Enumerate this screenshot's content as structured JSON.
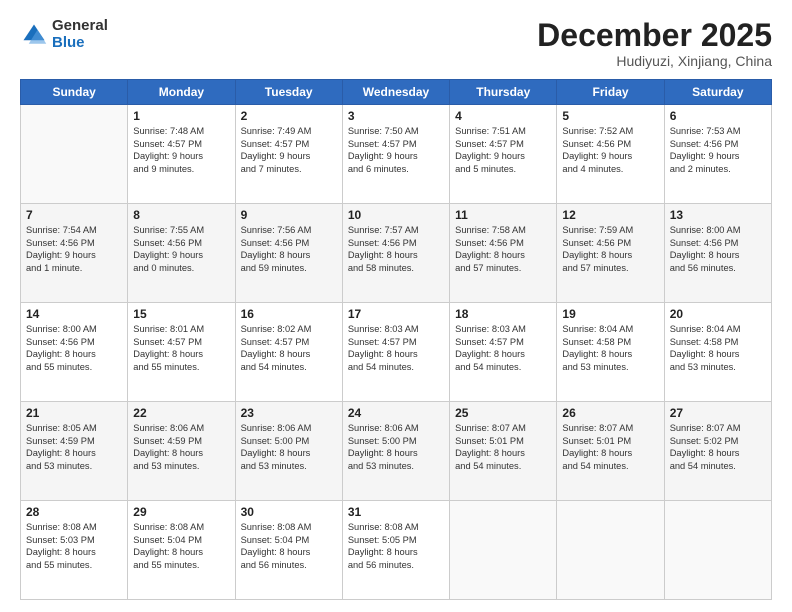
{
  "logo": {
    "general": "General",
    "blue": "Blue"
  },
  "header": {
    "title": "December 2025",
    "subtitle": "Hudiyuzi, Xinjiang, China"
  },
  "weekdays": [
    "Sunday",
    "Monday",
    "Tuesday",
    "Wednesday",
    "Thursday",
    "Friday",
    "Saturday"
  ],
  "weeks": [
    [
      {
        "day": "",
        "lines": []
      },
      {
        "day": "1",
        "lines": [
          "Sunrise: 7:48 AM",
          "Sunset: 4:57 PM",
          "Daylight: 9 hours",
          "and 9 minutes."
        ]
      },
      {
        "day": "2",
        "lines": [
          "Sunrise: 7:49 AM",
          "Sunset: 4:57 PM",
          "Daylight: 9 hours",
          "and 7 minutes."
        ]
      },
      {
        "day": "3",
        "lines": [
          "Sunrise: 7:50 AM",
          "Sunset: 4:57 PM",
          "Daylight: 9 hours",
          "and 6 minutes."
        ]
      },
      {
        "day": "4",
        "lines": [
          "Sunrise: 7:51 AM",
          "Sunset: 4:57 PM",
          "Daylight: 9 hours",
          "and 5 minutes."
        ]
      },
      {
        "day": "5",
        "lines": [
          "Sunrise: 7:52 AM",
          "Sunset: 4:56 PM",
          "Daylight: 9 hours",
          "and 4 minutes."
        ]
      },
      {
        "day": "6",
        "lines": [
          "Sunrise: 7:53 AM",
          "Sunset: 4:56 PM",
          "Daylight: 9 hours",
          "and 2 minutes."
        ]
      }
    ],
    [
      {
        "day": "7",
        "lines": [
          "Sunrise: 7:54 AM",
          "Sunset: 4:56 PM",
          "Daylight: 9 hours",
          "and 1 minute."
        ]
      },
      {
        "day": "8",
        "lines": [
          "Sunrise: 7:55 AM",
          "Sunset: 4:56 PM",
          "Daylight: 9 hours",
          "and 0 minutes."
        ]
      },
      {
        "day": "9",
        "lines": [
          "Sunrise: 7:56 AM",
          "Sunset: 4:56 PM",
          "Daylight: 8 hours",
          "and 59 minutes."
        ]
      },
      {
        "day": "10",
        "lines": [
          "Sunrise: 7:57 AM",
          "Sunset: 4:56 PM",
          "Daylight: 8 hours",
          "and 58 minutes."
        ]
      },
      {
        "day": "11",
        "lines": [
          "Sunrise: 7:58 AM",
          "Sunset: 4:56 PM",
          "Daylight: 8 hours",
          "and 57 minutes."
        ]
      },
      {
        "day": "12",
        "lines": [
          "Sunrise: 7:59 AM",
          "Sunset: 4:56 PM",
          "Daylight: 8 hours",
          "and 57 minutes."
        ]
      },
      {
        "day": "13",
        "lines": [
          "Sunrise: 8:00 AM",
          "Sunset: 4:56 PM",
          "Daylight: 8 hours",
          "and 56 minutes."
        ]
      }
    ],
    [
      {
        "day": "14",
        "lines": [
          "Sunrise: 8:00 AM",
          "Sunset: 4:56 PM",
          "Daylight: 8 hours",
          "and 55 minutes."
        ]
      },
      {
        "day": "15",
        "lines": [
          "Sunrise: 8:01 AM",
          "Sunset: 4:57 PM",
          "Daylight: 8 hours",
          "and 55 minutes."
        ]
      },
      {
        "day": "16",
        "lines": [
          "Sunrise: 8:02 AM",
          "Sunset: 4:57 PM",
          "Daylight: 8 hours",
          "and 54 minutes."
        ]
      },
      {
        "day": "17",
        "lines": [
          "Sunrise: 8:03 AM",
          "Sunset: 4:57 PM",
          "Daylight: 8 hours",
          "and 54 minutes."
        ]
      },
      {
        "day": "18",
        "lines": [
          "Sunrise: 8:03 AM",
          "Sunset: 4:57 PM",
          "Daylight: 8 hours",
          "and 54 minutes."
        ]
      },
      {
        "day": "19",
        "lines": [
          "Sunrise: 8:04 AM",
          "Sunset: 4:58 PM",
          "Daylight: 8 hours",
          "and 53 minutes."
        ]
      },
      {
        "day": "20",
        "lines": [
          "Sunrise: 8:04 AM",
          "Sunset: 4:58 PM",
          "Daylight: 8 hours",
          "and 53 minutes."
        ]
      }
    ],
    [
      {
        "day": "21",
        "lines": [
          "Sunrise: 8:05 AM",
          "Sunset: 4:59 PM",
          "Daylight: 8 hours",
          "and 53 minutes."
        ]
      },
      {
        "day": "22",
        "lines": [
          "Sunrise: 8:06 AM",
          "Sunset: 4:59 PM",
          "Daylight: 8 hours",
          "and 53 minutes."
        ]
      },
      {
        "day": "23",
        "lines": [
          "Sunrise: 8:06 AM",
          "Sunset: 5:00 PM",
          "Daylight: 8 hours",
          "and 53 minutes."
        ]
      },
      {
        "day": "24",
        "lines": [
          "Sunrise: 8:06 AM",
          "Sunset: 5:00 PM",
          "Daylight: 8 hours",
          "and 53 minutes."
        ]
      },
      {
        "day": "25",
        "lines": [
          "Sunrise: 8:07 AM",
          "Sunset: 5:01 PM",
          "Daylight: 8 hours",
          "and 54 minutes."
        ]
      },
      {
        "day": "26",
        "lines": [
          "Sunrise: 8:07 AM",
          "Sunset: 5:01 PM",
          "Daylight: 8 hours",
          "and 54 minutes."
        ]
      },
      {
        "day": "27",
        "lines": [
          "Sunrise: 8:07 AM",
          "Sunset: 5:02 PM",
          "Daylight: 8 hours",
          "and 54 minutes."
        ]
      }
    ],
    [
      {
        "day": "28",
        "lines": [
          "Sunrise: 8:08 AM",
          "Sunset: 5:03 PM",
          "Daylight: 8 hours",
          "and 55 minutes."
        ]
      },
      {
        "day": "29",
        "lines": [
          "Sunrise: 8:08 AM",
          "Sunset: 5:04 PM",
          "Daylight: 8 hours",
          "and 55 minutes."
        ]
      },
      {
        "day": "30",
        "lines": [
          "Sunrise: 8:08 AM",
          "Sunset: 5:04 PM",
          "Daylight: 8 hours",
          "and 56 minutes."
        ]
      },
      {
        "day": "31",
        "lines": [
          "Sunrise: 8:08 AM",
          "Sunset: 5:05 PM",
          "Daylight: 8 hours",
          "and 56 minutes."
        ]
      },
      {
        "day": "",
        "lines": []
      },
      {
        "day": "",
        "lines": []
      },
      {
        "day": "",
        "lines": []
      }
    ]
  ]
}
